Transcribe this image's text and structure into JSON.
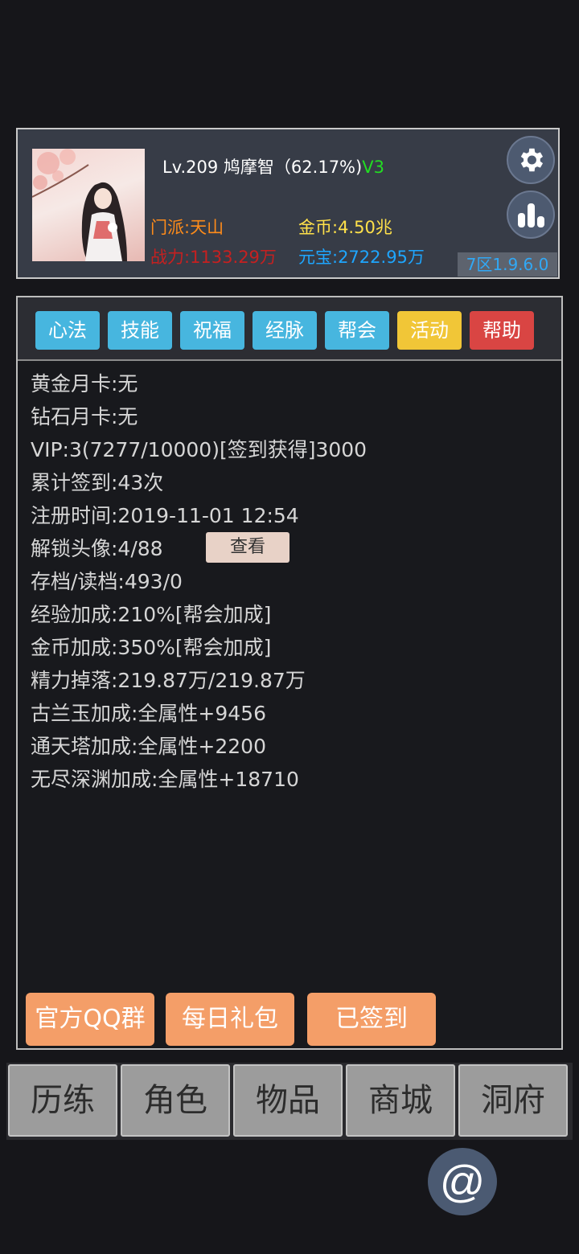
{
  "profile": {
    "title_prefix": "Lv.209 鸠摩智（62.17%)",
    "vip_badge": "V3",
    "sect": "门派:天山",
    "gold": "金币:4.50兆",
    "power": "战力:1133.29万",
    "yuanbao": "元宝:2722.95万",
    "server": "7区1.9.6.0",
    "settings_icon": "gear-icon",
    "stats_icon": "bar-chart-icon"
  },
  "tabs": [
    {
      "label": "心法",
      "color": "#47b6df"
    },
    {
      "label": "技能",
      "color": "#47b6df"
    },
    {
      "label": "祝福",
      "color": "#47b6df"
    },
    {
      "label": "经脉",
      "color": "#47b6df"
    },
    {
      "label": "帮会",
      "color": "#47b6df"
    },
    {
      "label": "活动",
      "color": "#f1c637"
    },
    {
      "label": "帮助",
      "color": "#d94543"
    }
  ],
  "info": [
    "黄金月卡:无",
    "钻石月卡:无",
    "VIP:3(7277/10000)[签到获得]3000",
    "累计签到:43次",
    "注册时间:2019-11-01 12:54",
    "解锁头像:4/88",
    "存档/读档:493/0",
    "经验加成:210%[帮会加成]",
    "金币加成:350%[帮会加成]",
    "精力掉落:219.87万/219.87万",
    "古兰玉加成:全属性+9456",
    "通天塔加成:全属性+2200",
    "无尽深渊加成:全属性+18710"
  ],
  "view_button": "查看",
  "actions": [
    "官方QQ群",
    "每日礼包",
    "已签到"
  ],
  "nav": [
    "历练",
    "角色",
    "物品",
    "商城",
    "洞府"
  ],
  "at_button": "@"
}
